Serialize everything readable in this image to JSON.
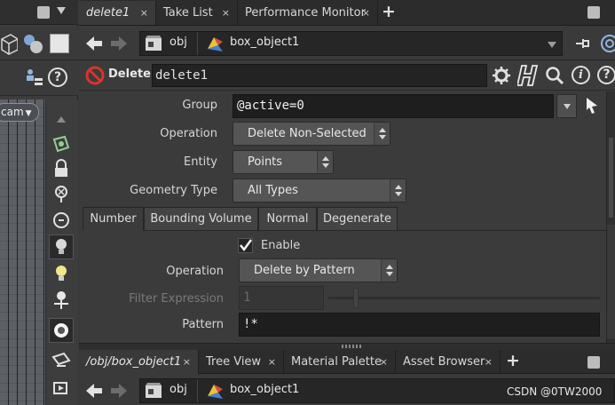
{
  "main_tabs": [
    {
      "label": "delete1",
      "active": true
    },
    {
      "label": "Take List",
      "active": false
    },
    {
      "label": "Performance Monitor",
      "active": false
    }
  ],
  "tab_close_glyph": "×",
  "plus_glyph": "+",
  "path": {
    "context": "obj",
    "object": "box_object1"
  },
  "left": {
    "cam_label": "cam"
  },
  "node": {
    "type_label": "Delete",
    "name": "delete1"
  },
  "params": {
    "group_label": "Group",
    "group_value": "@active=0",
    "operation_label": "Operation",
    "operation_value": "Delete Non-Selected",
    "entity_label": "Entity",
    "entity_value": "Points",
    "geometry_type_label": "Geometry Type",
    "geometry_type_value": "All Types"
  },
  "sub_tabs": [
    "Number",
    "Bounding Volume",
    "Normal",
    "Degenerate"
  ],
  "number_tab": {
    "enable_label": "Enable",
    "enable_checked": true,
    "operation_label": "Operation",
    "operation_value": "Delete by Pattern",
    "filter_label": "Filter Expression",
    "filter_value": "1",
    "pattern_label": "Pattern",
    "pattern_value": "!*"
  },
  "bottom_tabs": [
    {
      "label": "/obj/box_object1",
      "active": true
    },
    {
      "label": "Tree View",
      "active": false
    },
    {
      "label": "Material Palette",
      "active": false
    },
    {
      "label": "Asset Browser",
      "active": false
    }
  ],
  "bottom_path": {
    "context": "obj",
    "object": "box_object1"
  },
  "watermark": "CSDN @0TW2000",
  "colors": {
    "panel": "#3b3b3b",
    "field": "#1e1e1e",
    "menu": "#555555",
    "delete_icon": "#d9342b"
  }
}
